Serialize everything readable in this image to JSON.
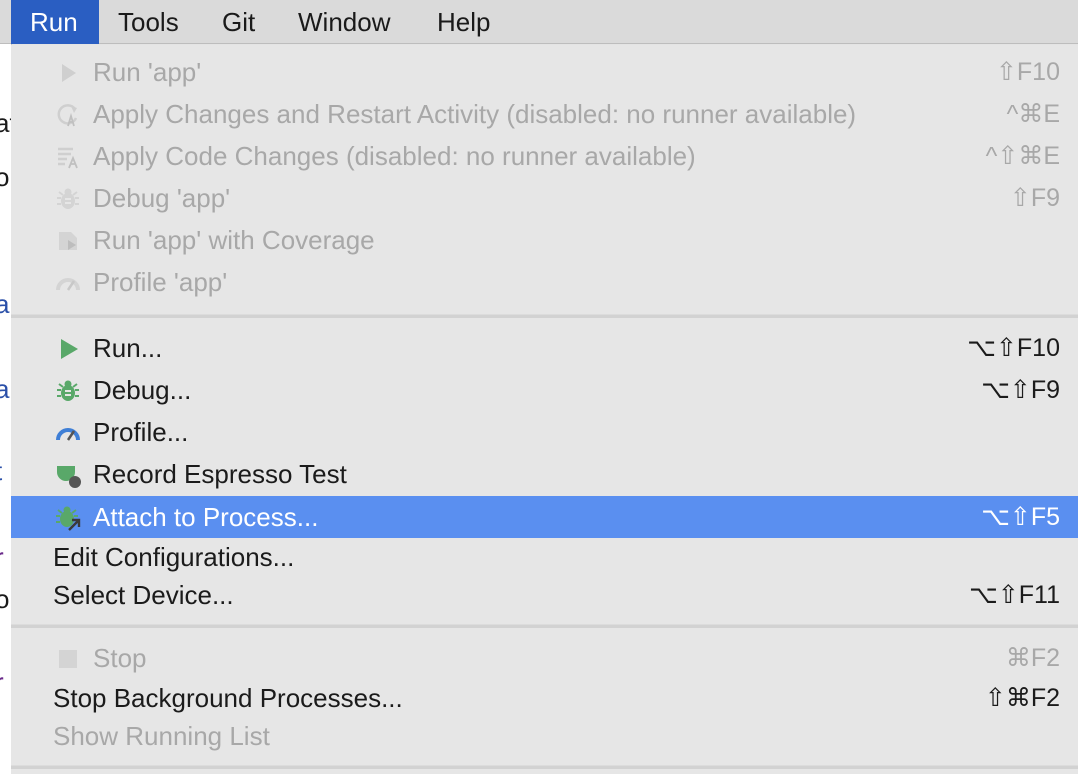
{
  "menubar": {
    "items": [
      {
        "label": "Run",
        "active": true
      },
      {
        "label": "Tools"
      },
      {
        "label": "Git"
      },
      {
        "label": "Window"
      },
      {
        "label": "Help"
      }
    ]
  },
  "run_menu": {
    "items": [
      {
        "label": "Run 'app'",
        "shortcut": "⇧F10",
        "icon": "run-icon",
        "enabled": false
      },
      {
        "label": "Apply Changes and Restart Activity (disabled: no runner available)",
        "shortcut": "^⌘E",
        "icon": "apply-changes-icon",
        "enabled": false
      },
      {
        "label": "Apply Code Changes (disabled: no runner available)",
        "shortcut": "^⇧⌘E",
        "icon": "apply-code-changes-icon",
        "enabled": false
      },
      {
        "label": "Debug 'app'",
        "shortcut": "⇧F9",
        "icon": "debug-bug-icon",
        "enabled": false
      },
      {
        "label": "Run 'app' with Coverage",
        "shortcut": "",
        "icon": "coverage-icon",
        "enabled": false
      },
      {
        "label": "Profile 'app'",
        "shortcut": "",
        "icon": "profile-gauge-icon",
        "enabled": false
      },
      {
        "label": "Run...",
        "shortcut": "⌥⇧F10",
        "icon": "run-icon",
        "enabled": true
      },
      {
        "label": "Debug...",
        "shortcut": "⌥⇧F9",
        "icon": "debug-bug-icon",
        "enabled": true
      },
      {
        "label": "Profile...",
        "shortcut": "",
        "icon": "profile-gauge-icon",
        "enabled": true
      },
      {
        "label": "Record Espresso Test",
        "shortcut": "",
        "icon": "espresso-icon",
        "enabled": true
      },
      {
        "label": "Attach to Process...",
        "shortcut": "⌥⇧F5",
        "icon": "attach-process-icon",
        "enabled": true,
        "selected": true
      },
      {
        "label": "Edit Configurations...",
        "shortcut": "",
        "enabled": true
      },
      {
        "label": "Select Device...",
        "shortcut": "⌥⇧F11",
        "enabled": true
      },
      {
        "label": "Stop",
        "shortcut": "⌘F2",
        "icon": "stop-icon",
        "enabled": false
      },
      {
        "label": "Stop Background Processes...",
        "shortcut": "⇧⌘F2",
        "enabled": true
      },
      {
        "label": "Show Running List",
        "shortcut": "",
        "enabled": false
      }
    ]
  },
  "colors": {
    "menubar_active": "#2a5ec2",
    "selection": "#5a8ff0",
    "icon_green": "#59a869",
    "icon_blue": "#3f7fd6",
    "disabled_text": "#a8a8a8"
  }
}
